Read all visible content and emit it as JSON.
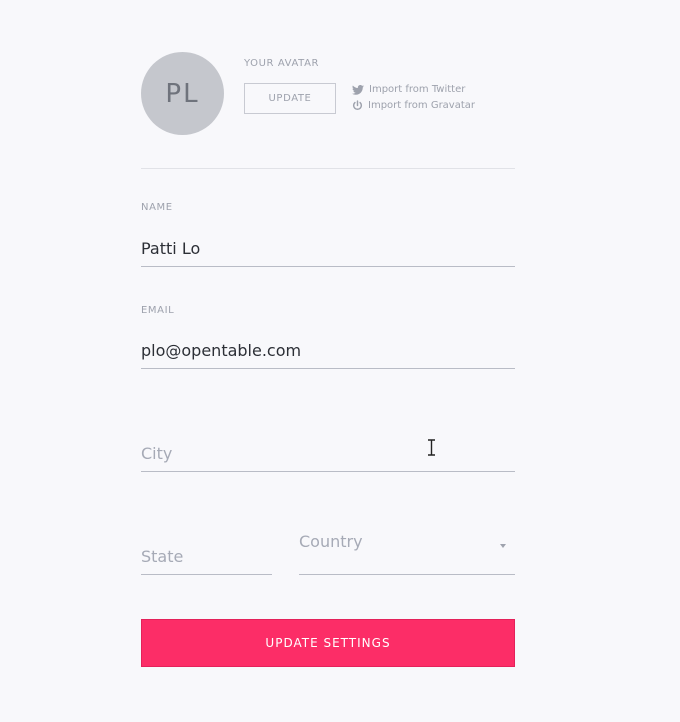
{
  "avatar": {
    "initials": "PL",
    "label": "YOUR AVATAR",
    "update_label": "UPDATE",
    "import_twitter": "Import from Twitter",
    "import_gravatar": "Import from Gravatar"
  },
  "fields": {
    "name": {
      "label": "NAME",
      "value": "Patti Lo"
    },
    "email": {
      "label": "EMAIL",
      "value": "plo@opentable.com"
    },
    "city": {
      "placeholder": "City",
      "value": ""
    },
    "state": {
      "placeholder": "State",
      "value": ""
    },
    "country": {
      "selected": "Country"
    }
  },
  "submit_label": "UPDATE SETTINGS",
  "colors": {
    "background": "#f8f8fb",
    "accent": "#fc2d67",
    "avatar_bg": "#c5c7cd",
    "muted_text": "#9ea2ad"
  }
}
